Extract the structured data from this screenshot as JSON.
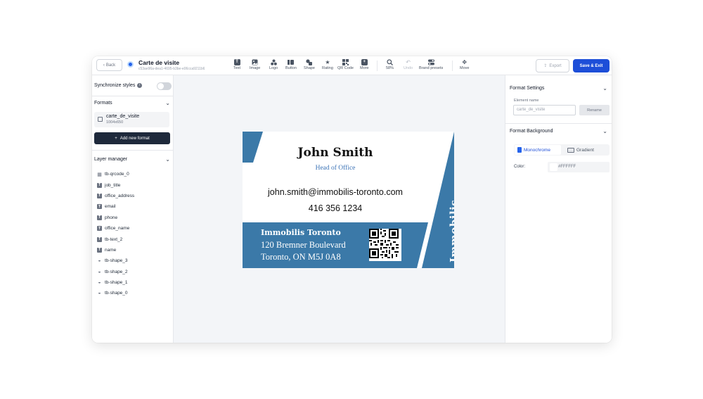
{
  "toolbar": {
    "back_label": "Back",
    "doc_title": "Carte de visite",
    "doc_id": "c53ae96a-dea1-4695-b3be-e06cca9211b6",
    "tools": [
      {
        "label": "Text",
        "icon": "text-icon"
      },
      {
        "label": "Image",
        "icon": "image-icon"
      },
      {
        "label": "Logo",
        "icon": "logo-icon"
      },
      {
        "label": "Button",
        "icon": "button-icon"
      },
      {
        "label": "Shape",
        "icon": "shape-icon"
      },
      {
        "label": "Rating",
        "icon": "star-icon"
      },
      {
        "label": "QR Code",
        "icon": "qr-code-icon"
      },
      {
        "label": "More",
        "icon": "plus-icon"
      }
    ],
    "zoom": "58%",
    "undo_label": "Undo",
    "brand_presets_label": "Brand presets",
    "move_label": "Move",
    "export_label": "Export",
    "save_label": "Save & Exit"
  },
  "left_panel": {
    "sync_label": "Synchronize styles",
    "formats_label": "Formats",
    "format_item": {
      "name": "carte_de_visite",
      "size": "1004x650"
    },
    "add_format_label": "Add new format",
    "layer_manager_label": "Layer manager",
    "layers": [
      {
        "name": "tb-qrcode_0",
        "type": "qr"
      },
      {
        "name": "job_title",
        "type": "text"
      },
      {
        "name": "office_address",
        "type": "text"
      },
      {
        "name": "email",
        "type": "text"
      },
      {
        "name": "phone",
        "type": "text"
      },
      {
        "name": "office_name",
        "type": "text"
      },
      {
        "name": "tb-text_2",
        "type": "text"
      },
      {
        "name": "name",
        "type": "text"
      },
      {
        "name": "tb-shape_3",
        "type": "shape"
      },
      {
        "name": "tb-shape_2",
        "type": "shape"
      },
      {
        "name": "tb-shape_1",
        "type": "shape"
      },
      {
        "name": "tb-shape_0",
        "type": "shape"
      }
    ]
  },
  "card": {
    "name": "John Smith",
    "job_title": "Head of Office",
    "email": "john.smith@immobilis-toronto.com",
    "phone": "416 356 1234",
    "office_name": "Immobilis Toronto",
    "address_line1": "120 Bremner Boulevard",
    "address_line2": "Toronto, ON M5J 0A8",
    "brand": "Immobilis",
    "accent_color": "#3b79a8"
  },
  "right_panel": {
    "format_settings_label": "Format Settings",
    "element_name_label": "Element name",
    "element_name_value": "carte_de_visite",
    "rename_label": "Rename",
    "format_background_label": "Format Background",
    "monochrome_label": "Monochrome",
    "gradient_label": "Gradient",
    "color_label": "Color:",
    "color_value": "#FFFFFF"
  }
}
